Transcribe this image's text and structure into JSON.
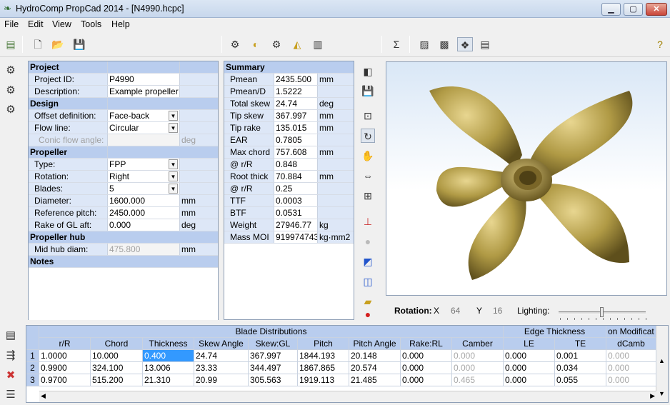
{
  "window": {
    "title": "HydroComp PropCad 2014 - [N4990.hcpc]",
    "min": "▁",
    "max": "▢",
    "close": "✕"
  },
  "menu": [
    "File",
    "Edit",
    "View",
    "Tools",
    "Help"
  ],
  "toolbar_icons": [
    "new-file-icon",
    "open-folder-icon",
    "save-icon",
    "propeller-wizard-icon",
    "blade-icon",
    "hub-icon",
    "export-icon",
    "report-icon",
    "sigma-calc-icon",
    "chart-icon",
    "image-icon",
    "view-3d-icon",
    "document-icon",
    "help-icon"
  ],
  "project": {
    "header": "Project",
    "rows": [
      {
        "label": "Project ID:",
        "value": "P4990"
      },
      {
        "label": "Description:",
        "value": "Example propeller"
      }
    ]
  },
  "design": {
    "header": "Design",
    "rows": [
      {
        "label": "Offset definition:",
        "value": "Face-back"
      },
      {
        "label": "Flow line:",
        "value": "Circular"
      },
      {
        "label": "Conic flow angle:",
        "value": "",
        "unit": "deg"
      }
    ]
  },
  "propeller": {
    "header": "Propeller",
    "rows": [
      {
        "label": "Type:",
        "value": "FPP"
      },
      {
        "label": "Rotation:",
        "value": "Right"
      },
      {
        "label": "Blades:",
        "value": "5"
      },
      {
        "label": "Diameter:",
        "value": "1600.000",
        "unit": "mm"
      },
      {
        "label": "Reference pitch:",
        "value": "2450.000",
        "unit": "mm"
      },
      {
        "label": "Rake of GL aft:",
        "value": "0.000",
        "unit": "deg"
      }
    ]
  },
  "hub": {
    "header": "Propeller hub",
    "rows": [
      {
        "label": "Mid hub diam:",
        "value": "475.800",
        "unit": "mm"
      }
    ]
  },
  "notes": {
    "header": "Notes"
  },
  "summary": {
    "header": "Summary",
    "rows": [
      {
        "label": "Pmean",
        "value": "2435.500",
        "unit": "mm"
      },
      {
        "label": "Pmean/D",
        "value": "1.5222",
        "unit": ""
      },
      {
        "label": "Total skew",
        "value": "24.74",
        "unit": "deg"
      },
      {
        "label": "Tip skew",
        "value": "367.997",
        "unit": "mm"
      },
      {
        "label": "Tip rake",
        "value": "135.015",
        "unit": "mm"
      },
      {
        "label": "EAR",
        "value": "0.7805",
        "unit": ""
      },
      {
        "label": "Max chord",
        "value": "757.608",
        "unit": "mm"
      },
      {
        "label": "@ r/R",
        "value": "0.848",
        "unit": ""
      },
      {
        "label": "Root thick",
        "value": "70.884",
        "unit": "mm"
      },
      {
        "label": "@ r/R",
        "value": "0.25",
        "unit": ""
      },
      {
        "label": "TTF",
        "value": "0.0003",
        "unit": ""
      },
      {
        "label": "BTF",
        "value": "0.0531",
        "unit": ""
      },
      {
        "label": "Weight",
        "value": "27946.77",
        "unit": "kg"
      },
      {
        "label": "Mass MOI",
        "value": "919974743",
        "unit": "kg·mm2"
      }
    ]
  },
  "view": {
    "rotation_label": "Rotation:",
    "x_label": "X",
    "x_value": "64",
    "y_label": "Y",
    "y_value": "16",
    "lighting_label": "Lighting:",
    "lighting_level": 0.5,
    "propeller_color": "#b09a45"
  },
  "grid": {
    "group_headers": {
      "blade": "Blade Distributions",
      "edge": "Edge Thickness",
      "mod": "on Modificat"
    },
    "columns": [
      "r/R",
      "Chord",
      "Thickness",
      "Skew Angle",
      "Skew:GL",
      "Pitch",
      "Pitch Angle",
      "Rake:RL",
      "Camber",
      "LE",
      "TE",
      "dCamb"
    ],
    "rows": [
      {
        "n": "1",
        "cells": [
          "1.0000",
          "10.000",
          "0.400",
          "24.74",
          "367.997",
          "1844.193",
          "20.148",
          "0.000",
          "0.000",
          "0.000",
          "0.001",
          "0.000"
        ]
      },
      {
        "n": "2",
        "cells": [
          "0.9900",
          "324.100",
          "13.006",
          "23.33",
          "344.497",
          "1867.865",
          "20.574",
          "0.000",
          "0.000",
          "0.000",
          "0.034",
          "0.000"
        ]
      },
      {
        "n": "3",
        "cells": [
          "0.9700",
          "515.200",
          "21.310",
          "20.99",
          "305.563",
          "1919.113",
          "21.485",
          "0.000",
          "0.465",
          "0.000",
          "0.055",
          "0.000"
        ]
      }
    ]
  }
}
